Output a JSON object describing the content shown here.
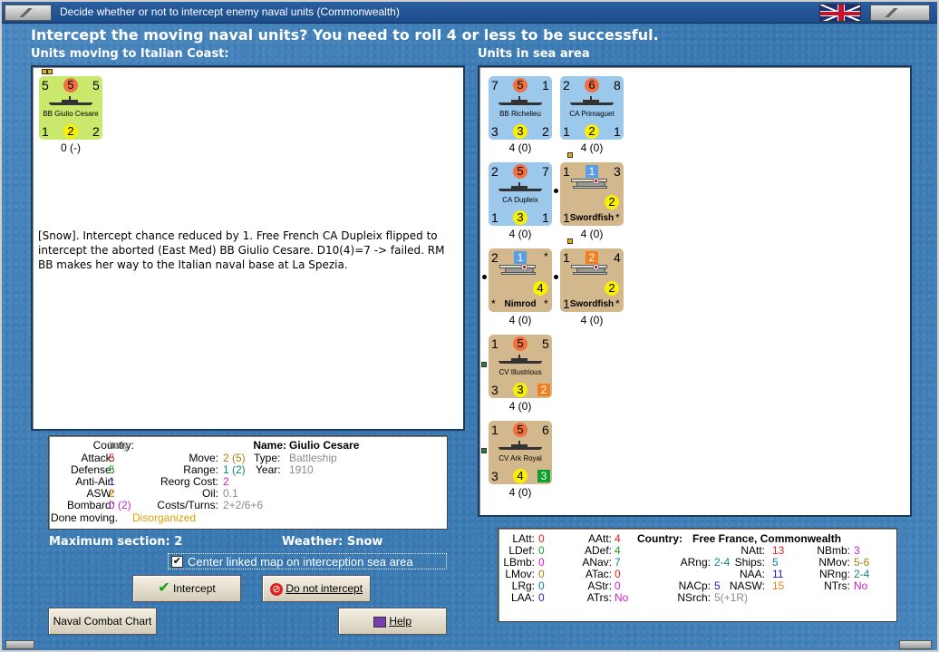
{
  "window": {
    "title": "Decide whether or not to intercept enemy naval units (Commonwealth)"
  },
  "heading": "Intercept the moving naval units?  You need to roll 4 or less to be successful.",
  "left_label": "Units moving to Italian Coast:",
  "right_label": "Units in sea area",
  "moving_unit": {
    "att": "5",
    "def": "5",
    "top_circle": "5",
    "name": "BB Giulio Cesare",
    "bl": "1",
    "bm": "2",
    "br": "2",
    "strength": "0 (-)"
  },
  "log_text": "[Snow].  Intercept chance reduced by 1.  Free French CA Dupleix flipped to intercept the aborted (East Med) BB Giulio Cesare. D10(4)=7 -> failed.  RM BB makes her way to the Italian naval base at La Spezia.",
  "sea_units": [
    {
      "name": "BB Richelieu",
      "tl": "7",
      "tc": "5",
      "tr": "1",
      "bl": "3",
      "bm": "3",
      "br": "2",
      "strength": "4 (0)"
    },
    {
      "name": "CA Primaguet",
      "tl": "2",
      "tc": "6",
      "tr": "8",
      "bl": "1",
      "bm": "2",
      "br": "1",
      "strength": "4 (0)"
    },
    {
      "name": "CA Dupleix",
      "tl": "2",
      "tc": "5",
      "tr": "7",
      "bl": "1",
      "bm": "3",
      "br": "1",
      "strength": "4 (0)"
    },
    {
      "name": "Swordfish",
      "tl": "1",
      "tc": "1",
      "tr": "3",
      "bl": "1",
      "bm": "2",
      "br": "*",
      "strength": "4 (0)"
    },
    {
      "name": "Nimrod",
      "tl": "2",
      "tc": "1",
      "tr": "*",
      "bl": "*",
      "bm": "4",
      "br": "*",
      "strength": "4 (0)"
    },
    {
      "name": "Swordfish",
      "tl": "1",
      "tc": "2",
      "tr": "4",
      "bl": "1",
      "bm": "2",
      "br": "*",
      "strength": "4 (0)"
    },
    {
      "name": "CV Illustrious",
      "tl": "1",
      "tc": "5",
      "tr": "5",
      "bl": "3",
      "bm": "3",
      "br": "2",
      "strength": "4 (0)"
    },
    {
      "name": "CV Ark Royal",
      "tl": "1",
      "tc": "5",
      "tr": "6",
      "bl": "3",
      "bm": "4",
      "br": "3",
      "strength": "4 (0)"
    }
  ],
  "details": {
    "country_label": "Country:",
    "country": "Italy",
    "attack_label": "Attack:",
    "attack": "5",
    "defense_label": "Defense:",
    "defense": "5",
    "antiair_label": "Anti-Air:",
    "antiair": "1",
    "asw_label": "ASW:",
    "asw": "2",
    "bombard_label": "Bombard:",
    "bombard": "0 (2)",
    "done": "Done moving.",
    "status": "Disorganized",
    "name_label": "Name:",
    "name": "Giulio Cesare",
    "move_label": "Move:",
    "move": "2 (5)",
    "type_label": "Type:",
    "type": "Battleship",
    "range_label": "Range:",
    "range": "1 (2)",
    "year_label": "Year:",
    "year": "1910",
    "reorg_label": "Reorg Cost:",
    "reorg": "2",
    "oil_label": "Oil:",
    "oil": "0.1",
    "costs_label": "Costs/Turns:",
    "costs": "2+2/6+6"
  },
  "max_section": "Maximum section: 2",
  "weather": "Weather:  Snow",
  "center_checkbox": {
    "label": "Center linked map on interception sea area",
    "checked": "✔"
  },
  "buttons": {
    "intercept": "Intercept",
    "no_intercept": "Do not intercept",
    "chart": "Naval Combat Chart",
    "help": "Help"
  },
  "stats": {
    "country_label": "Country:",
    "country": "Free France, Commonwealth",
    "latt": "0",
    "ldef": "0",
    "lbmb": "0",
    "lmov": "0",
    "lrg": "0",
    "laa": "0",
    "aatt": "4",
    "adef": "4",
    "anav": "7",
    "atac": "0",
    "astr": "0",
    "atrs": "No",
    "natt": "13",
    "nbmb": "3",
    "arng": "2-4",
    "ships": "5",
    "nmov": "5-6",
    "naa": "11",
    "nrng": "2-4",
    "nacp": "5",
    "nasw": "15",
    "ntrs": "No",
    "nsrch": "5(+1R)"
  }
}
